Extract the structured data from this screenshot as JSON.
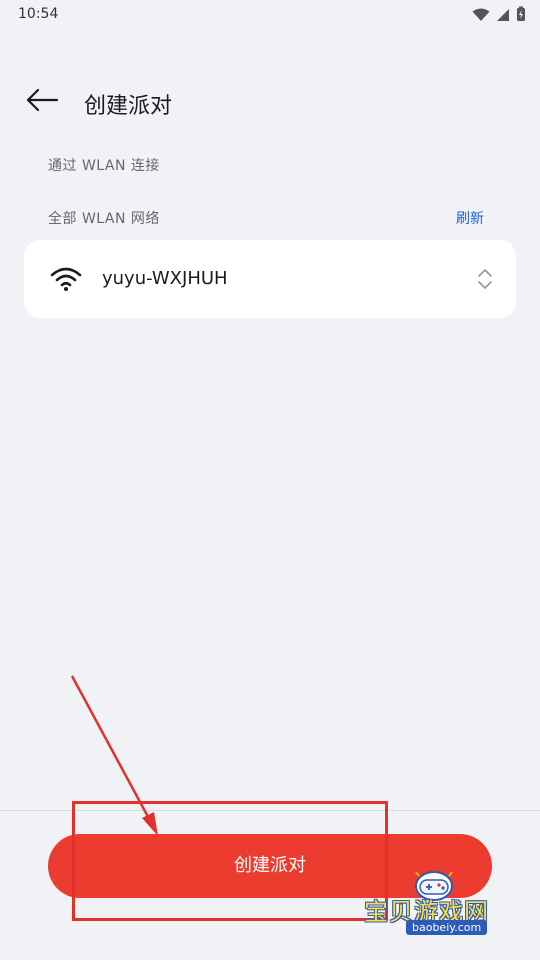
{
  "status_bar": {
    "time": "10:54",
    "icons": [
      "wifi-signal-icon",
      "cell-signal-icon",
      "battery-charging-icon"
    ]
  },
  "header": {
    "back_icon": "arrow-left-icon",
    "title": "创建派对"
  },
  "sections": {
    "connect_via_wlan": "通过 WLAN 连接",
    "all_wlan_networks": "全部 WLAN 网络",
    "refresh_label": "刷新"
  },
  "networks": [
    {
      "name": "yuyu-WXJHUH",
      "icon": "wifi-icon",
      "action_icon": "expand-collapse-icon"
    }
  ],
  "bottom": {
    "create_button_label": "创建派对"
  },
  "watermark": {
    "title": "宝贝游戏网",
    "url": "baobeiy.com"
  },
  "colors": {
    "background": "#f1f2f6",
    "accent_red": "#ec3b2f",
    "link_blue": "#1b62d3",
    "annotation_red": "#e2312a"
  }
}
